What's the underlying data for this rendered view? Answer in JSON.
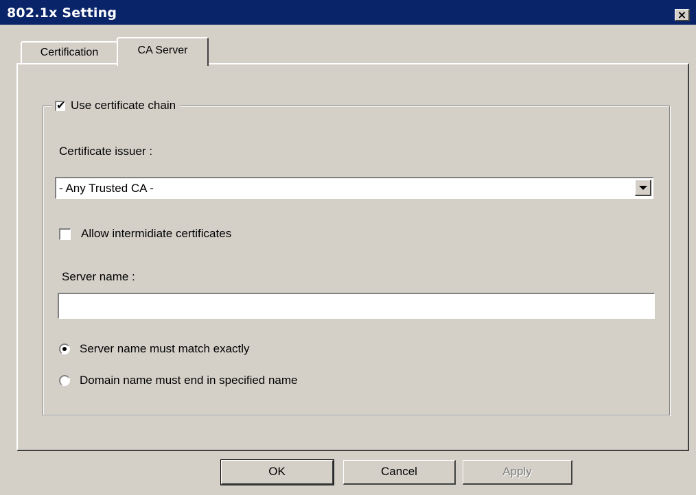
{
  "window": {
    "title": "802.1x Setting",
    "close_label": "×"
  },
  "tabs": [
    {
      "label": "Certification",
      "active": false
    },
    {
      "label": "CA Server",
      "active": true
    }
  ],
  "ca_server": {
    "use_chain": {
      "label": "Use certificate chain",
      "checked": true
    },
    "issuer_label": "Certificate issuer :",
    "issuer_value": "- Any Trusted CA -",
    "allow_intermediate": {
      "label": "Allow intermidiate certificates",
      "checked": false
    },
    "server_name_label": "Server name :",
    "server_name_value": "",
    "match_options": [
      {
        "label": "Server name must match exactly",
        "selected": true
      },
      {
        "label": "Domain name must end in specified name",
        "selected": false
      }
    ]
  },
  "buttons": {
    "ok": "OK",
    "cancel": "Cancel",
    "apply": "Apply"
  },
  "colors": {
    "titlebar": "#0a246a",
    "face": "#d4d0c8"
  }
}
